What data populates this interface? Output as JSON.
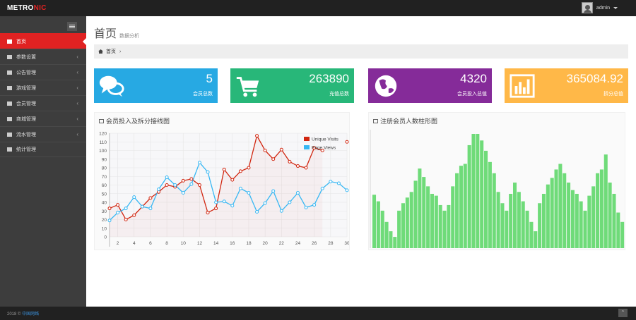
{
  "header": {
    "logo_prefix": "METRO",
    "logo_suffix": "NIC",
    "username": "admin"
  },
  "sidebar": {
    "items": [
      {
        "label": "首页",
        "icon": "home-icon",
        "active": true
      },
      {
        "label": "参数设置",
        "icon": "cogs-icon"
      },
      {
        "label": "公告管理",
        "icon": "user-icon"
      },
      {
        "label": "游戏管理",
        "icon": "user-icon"
      },
      {
        "label": "会员管理",
        "icon": "user-icon"
      },
      {
        "label": "商城管理",
        "icon": "table-icon"
      },
      {
        "label": "流水管理",
        "icon": "table-icon"
      },
      {
        "label": "统计管理",
        "icon": "bar-chart-icon"
      }
    ]
  },
  "page": {
    "title": "首页",
    "subtitle": "数据分析",
    "breadcrumb": "首页"
  },
  "stats": [
    {
      "number": "5",
      "desc": "会员总数",
      "color": "#27a9e3",
      "icon": "comments-icon"
    },
    {
      "number": "263890",
      "desc": "充值总数",
      "color": "#28b779",
      "icon": "shopping-cart-icon"
    },
    {
      "number": "4320",
      "desc": "会员投入总值",
      "color": "#852b99",
      "icon": "globe-icon"
    },
    {
      "number": "365084.92",
      "desc": "拆分总值",
      "color": "#ffb848",
      "icon": "bar-chart-icon"
    }
  ],
  "line_panel": {
    "title": "会员投入及拆分接线图"
  },
  "bar_panel": {
    "title": "注册会员人数柱形图"
  },
  "footer": {
    "year": "2018 ©",
    "link_text": "中国网络"
  },
  "colors": {
    "red": "#e02222",
    "visits": "#d12610",
    "views": "#37b7f3",
    "bars": "#6fdb79"
  },
  "chart_data": [
    {
      "type": "line",
      "title": "会员投入及拆分接线图",
      "x": [
        1,
        2,
        3,
        4,
        5,
        6,
        7,
        8,
        9,
        10,
        11,
        12,
        13,
        14,
        15,
        16,
        17,
        18,
        19,
        20,
        21,
        22,
        23,
        24,
        25,
        26,
        27,
        28,
        29,
        30
      ],
      "x_ticks": [
        2,
        4,
        6,
        8,
        10,
        12,
        14,
        16,
        18,
        20,
        22,
        24,
        26,
        28,
        30
      ],
      "y_ticks": [
        0,
        10,
        20,
        30,
        40,
        50,
        60,
        70,
        80,
        90,
        100,
        110,
        120
      ],
      "xlim": [
        1,
        30
      ],
      "ylim": [
        0,
        120
      ],
      "grid": true,
      "legend_position": "top-right",
      "series": [
        {
          "name": "Unique Visits",
          "values": [
            33,
            37,
            20,
            25,
            35,
            45,
            52,
            60,
            58,
            65,
            67,
            60,
            28,
            33,
            78,
            66,
            76,
            80,
            117,
            100,
            90,
            101,
            87,
            82,
            80,
            103,
            100,
            null,
            null,
            110
          ]
        },
        {
          "name": "Page Views",
          "values": [
            19,
            28,
            33,
            46,
            35,
            33,
            55,
            69,
            60,
            51,
            61,
            86,
            75,
            40,
            41,
            36,
            56,
            51,
            29,
            39,
            53,
            30,
            40,
            51,
            34,
            37,
            56,
            64,
            62,
            54
          ]
        }
      ]
    },
    {
      "type": "bar",
      "title": "注册会员人数柱形图",
      "values": [
        57,
        50,
        40,
        28,
        18,
        12,
        40,
        48,
        54,
        60,
        72,
        85,
        76,
        66,
        58,
        56,
        46,
        40,
        46,
        66,
        80,
        88,
        90,
        110,
        122,
        122,
        115,
        104,
        92,
        80,
        60,
        48,
        40,
        58,
        70,
        60,
        50,
        40,
        28,
        18,
        48,
        58,
        68,
        75,
        84,
        90,
        80,
        70,
        62,
        58,
        50,
        40,
        56,
        66,
        80,
        84,
        100,
        70,
        58,
        38,
        28
      ]
    }
  ]
}
